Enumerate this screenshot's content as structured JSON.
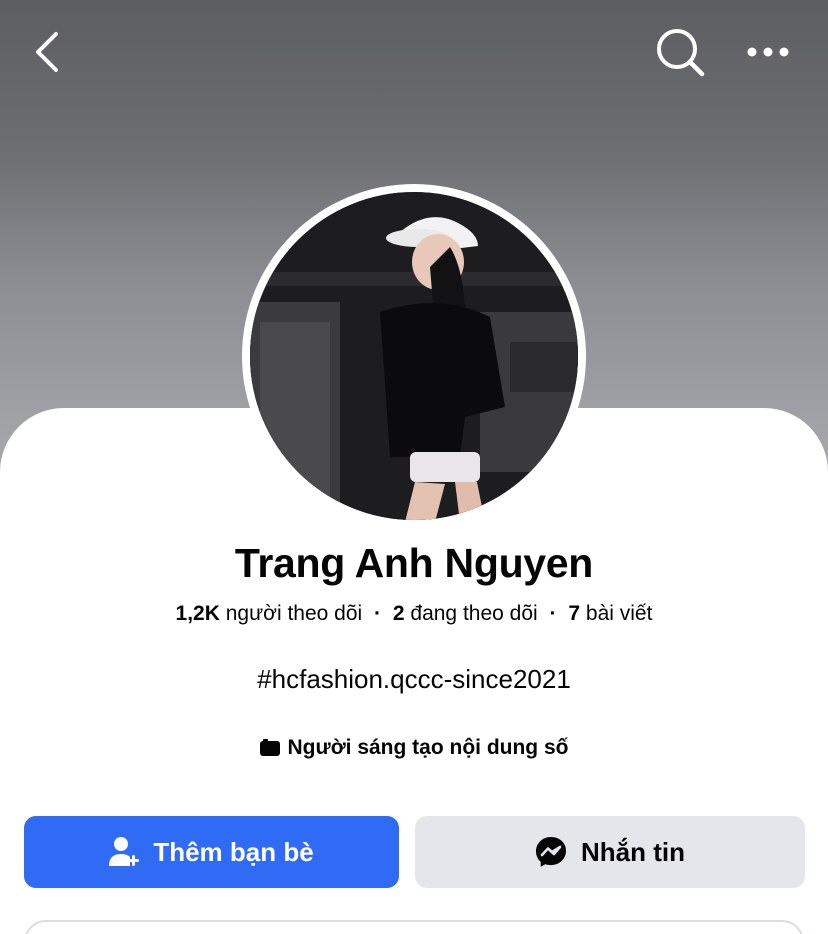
{
  "header": {
    "back_icon": "chevron-left-icon",
    "search_icon": "search-icon",
    "more_icon": "more-horizontal-icon"
  },
  "profile": {
    "name": "Trang Anh Nguyen",
    "followers_count": "1,2K",
    "followers_label": "người theo dõi",
    "following_count": "2",
    "following_label": "đang theo dõi",
    "posts_count": "7",
    "posts_label": "bài viết",
    "separator": "·",
    "bio": "#hcfashion.qccc-since2021",
    "category_icon": "video-creator-icon",
    "category": "Người sáng tạo nội dung số"
  },
  "actions": {
    "add_friend_label": "Thêm bạn bè",
    "add_friend_icon": "add-friend-icon",
    "message_label": "Nhắn tin",
    "message_icon": "messenger-icon"
  },
  "colors": {
    "primary_button": "#2f6bf5",
    "secondary_button": "#e4e6eb",
    "text": "#050505"
  }
}
